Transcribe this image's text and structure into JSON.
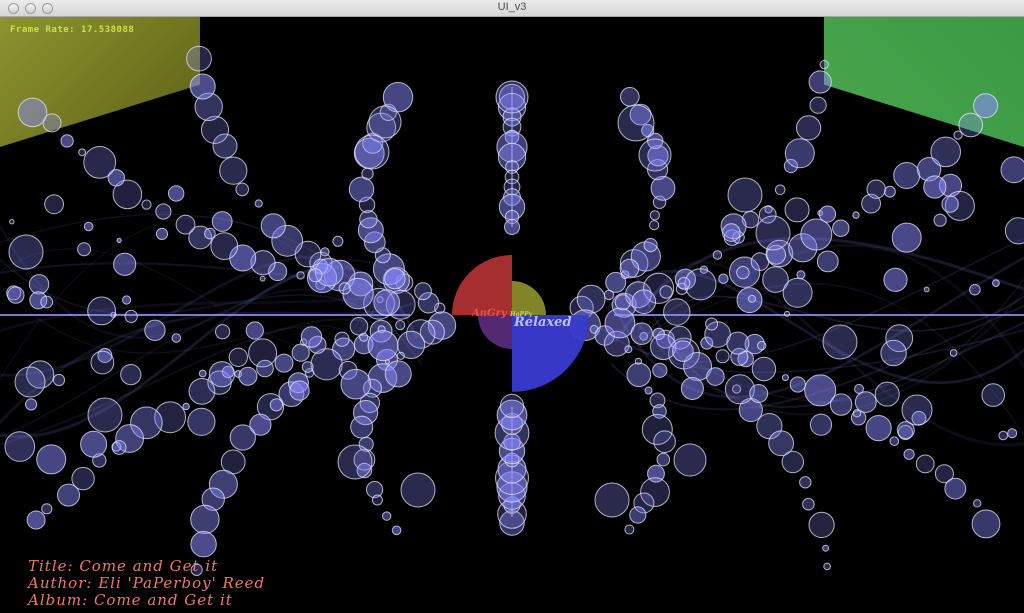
{
  "window": {
    "title": "UI_v3"
  },
  "overlay": {
    "frame_rate_text": "Frame Rate: 17.538088"
  },
  "song": {
    "title_line": "Title: Come and Get it",
    "author_line": "Author: Eli 'PaPerboy' Reed",
    "album_line": "Album: Come and Get it"
  },
  "mood_wheel": {
    "labels": {
      "angry": "AnGry",
      "happy": "HaPPy",
      "relaxed": "Relaxed"
    }
  },
  "colors": {
    "background": "#000000",
    "frame_rate_text": "#c8e04a",
    "song_text": "#f07a6a",
    "corner_left": "#8c9430",
    "corner_right": "#3a9a44",
    "angry_quadrant": "#b03030",
    "happy_quadrant": "#8a8a2a",
    "relaxed_quadrant": "#3a3ad0",
    "sad_quadrant": "#5a2a7a",
    "bubble_fill": "#8a8aff",
    "bubble_stroke": "#e8e8ff"
  }
}
